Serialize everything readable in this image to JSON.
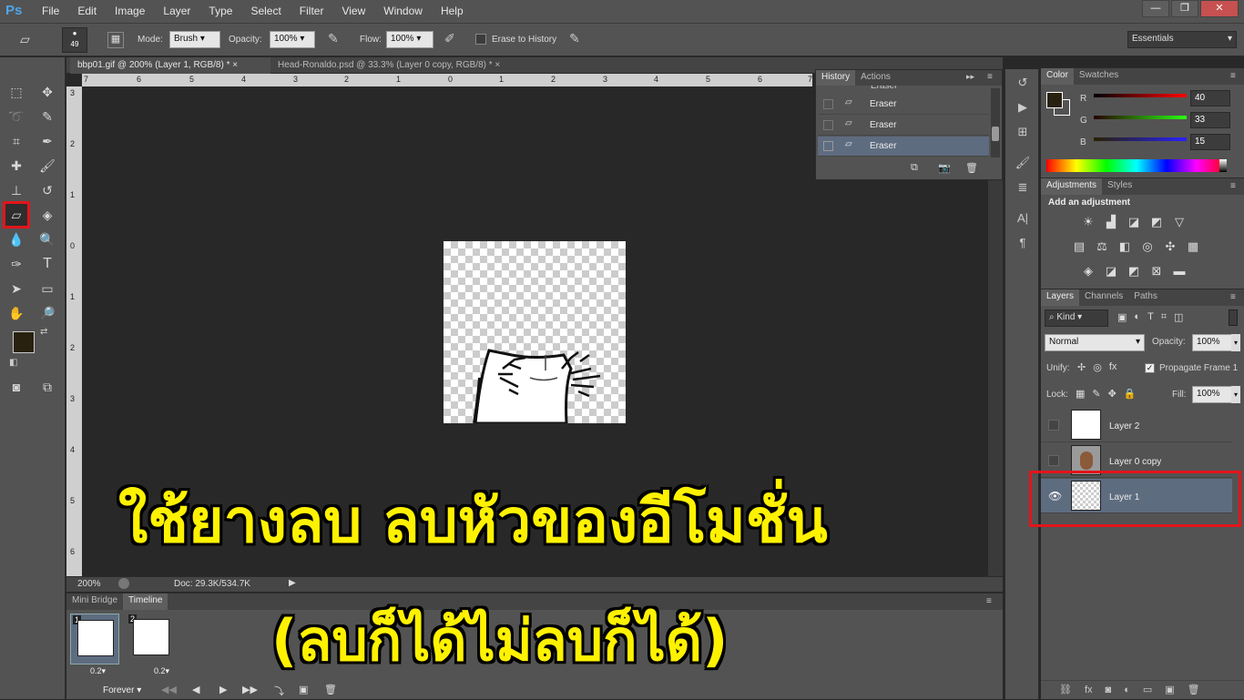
{
  "app": {
    "logo": "Ps"
  },
  "menu": [
    "File",
    "Edit",
    "Image",
    "Layer",
    "Type",
    "Select",
    "Filter",
    "View",
    "Window",
    "Help"
  ],
  "window_buttons": [
    "—",
    "❐",
    "✕"
  ],
  "options": {
    "brush_size": "49",
    "mode_label": "Mode:",
    "mode_value": "Brush",
    "opacity_label": "Opacity:",
    "opacity_value": "100%",
    "flow_label": "Flow:",
    "flow_value": "100%",
    "erase_history_label": "Erase to History",
    "workspace": "Essentials"
  },
  "doc_tabs": [
    {
      "label": "bbp01.gif @ 200% (Layer 1, RGB/8) *",
      "active": true
    },
    {
      "label": "Head-Ronaldo.psd @ 33.3% (Layer 0 copy, RGB/8) *",
      "active": false
    }
  ],
  "ruler_h": [
    "7",
    "6",
    "5",
    "4",
    "3",
    "2",
    "1",
    "0",
    "1",
    "2",
    "3",
    "4",
    "5",
    "6",
    "7"
  ],
  "ruler_v": [
    "3",
    "2",
    "1",
    "0",
    "1",
    "2",
    "3",
    "4",
    "5",
    "6"
  ],
  "status": {
    "zoom": "200%",
    "doc": "Doc: 29.3K/534.7K"
  },
  "overlay": {
    "line1": "ใช้ยางลบ ลบหัวของอีโมชั่น",
    "line2": "(ลบก็ได้ไม่ลบก็ได้)"
  },
  "timeline": {
    "tabs": [
      "Mini Bridge",
      "Timeline"
    ],
    "frames": [
      {
        "num": "1",
        "delay": "0.2▾"
      },
      {
        "num": "2",
        "delay": "0.2▾"
      }
    ],
    "loop": "Forever ▾"
  },
  "history": {
    "tabs": [
      "History",
      "Actions"
    ],
    "items": [
      "Eraser",
      "Eraser",
      "Eraser",
      "Eraser"
    ]
  },
  "color": {
    "tabs": [
      "Color",
      "Swatches"
    ],
    "r_label": "R",
    "r": "40",
    "g_label": "G",
    "g": "33",
    "b_label": "B",
    "b": "15",
    "foreground": "#28210f"
  },
  "adjustments": {
    "tabs": [
      "Adjustments",
      "Styles"
    ],
    "title": "Add an adjustment"
  },
  "layers": {
    "tabs": [
      "Layers",
      "Channels",
      "Paths"
    ],
    "kind": "Kind",
    "blend": "Normal",
    "opacity_label": "Opacity:",
    "opacity": "100%",
    "unify_label": "Unify:",
    "propagate": "Propagate Frame 1",
    "lock_label": "Lock:",
    "fill_label": "Fill:",
    "fill": "100%",
    "items": [
      {
        "name": "Layer 2",
        "visible": false
      },
      {
        "name": "Layer 0 copy",
        "visible": false
      },
      {
        "name": "Layer 1",
        "visible": true
      }
    ]
  }
}
